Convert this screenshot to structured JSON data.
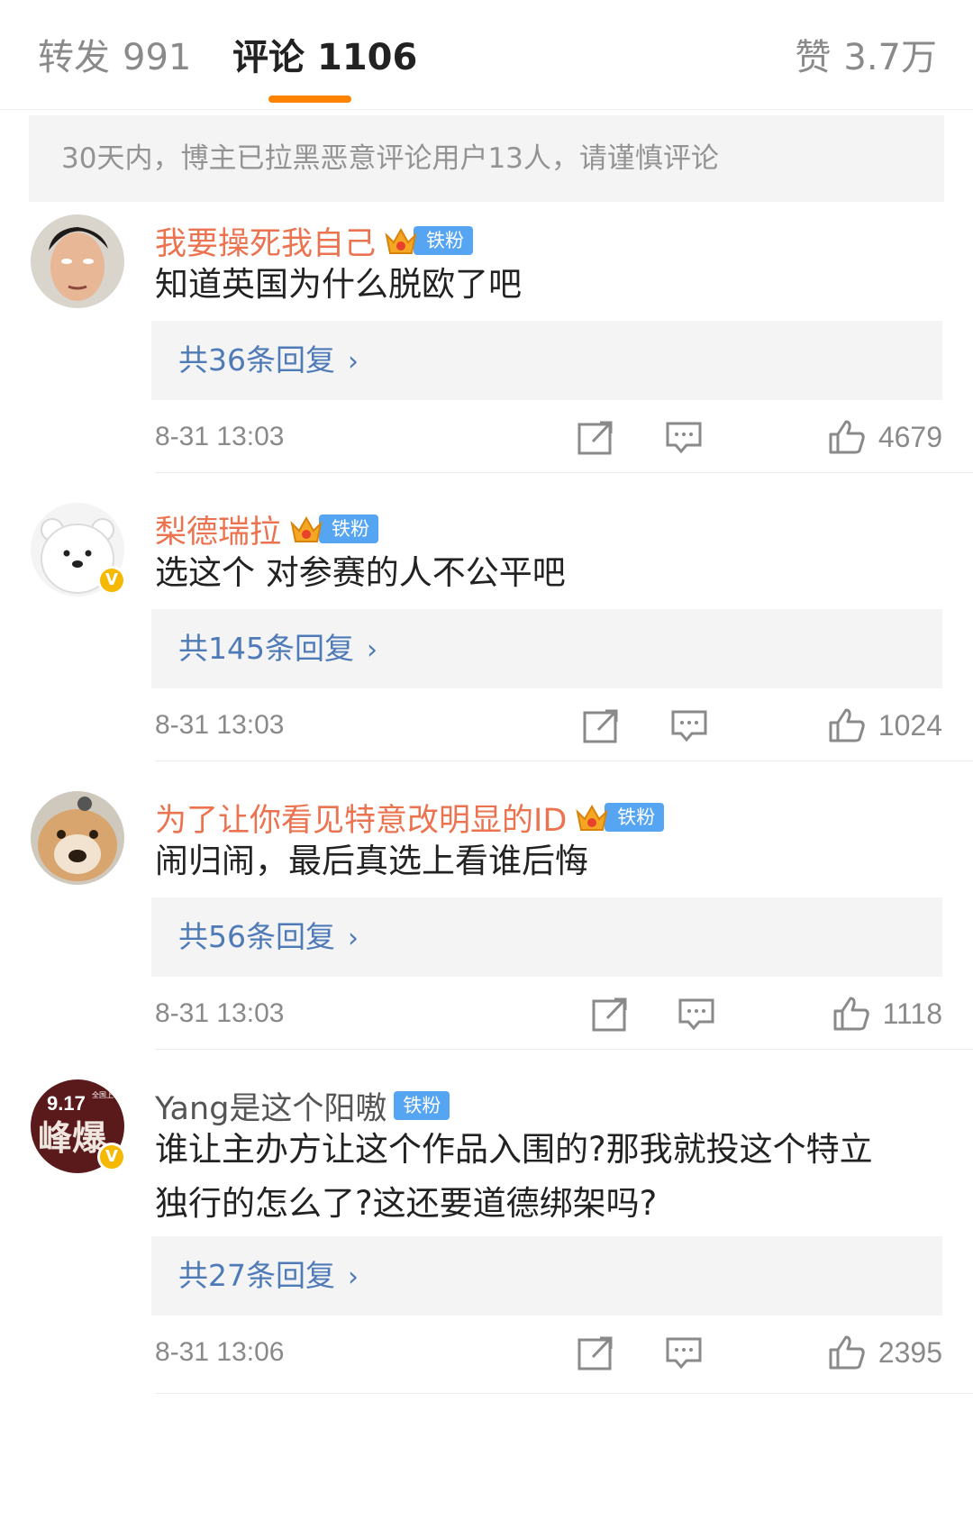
{
  "tabs": {
    "forward": {
      "label": "转发",
      "count": "991"
    },
    "comment": {
      "label": "评论",
      "count": "1106"
    },
    "like": {
      "label": "赞",
      "count": "3.7万"
    }
  },
  "notice": "30天内，博主已拉黑恶意评论用户13人，请谨慎评论",
  "fan_badge_label": "铁粉",
  "accent_color": "#ff8200",
  "comments": [
    {
      "username": "我要操死我自己",
      "content": "知道英国为什么脱欧了吧",
      "replies": "共36条回复",
      "time": "8-31 13:03",
      "likes": "4679"
    },
    {
      "username": "梨德瑞拉",
      "content": "选这个 对参赛的人不公平吧",
      "replies": "共145条回复",
      "time": "8-31 13:03",
      "likes": "1024"
    },
    {
      "username": "为了让你看见特意改明显的ID",
      "content": "闹归闹，最后真选上看谁后悔",
      "replies": "共56条回复",
      "time": "8-31 13:03",
      "likes": "1118"
    },
    {
      "username": "Yang是这个阳嗷",
      "content": "谁让主办方让这个作品入围的?那我就投这个特立独行的怎么了?这还要道德绑架吗?",
      "replies": "共27条回复",
      "time": "8-31 13:06",
      "likes": "2395",
      "avatar_text": {
        "date": "9.17",
        "release": "全国上映",
        "title": "峰爆"
      }
    }
  ]
}
